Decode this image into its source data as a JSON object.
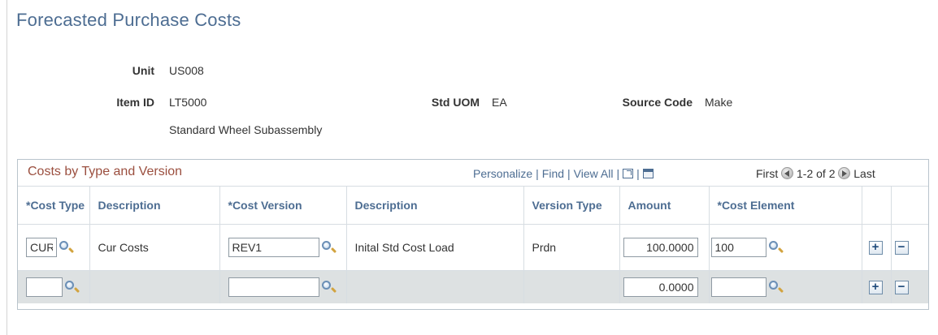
{
  "page": {
    "title": "Forecasted Purchase Costs"
  },
  "header": {
    "unit_label": "Unit",
    "unit_value": "US008",
    "item_label": "Item ID",
    "item_value": "LT5000",
    "item_description": "Standard Wheel Subassembly",
    "uom_label": "Std UOM",
    "uom_value": "EA",
    "source_label": "Source Code",
    "source_value": "Make"
  },
  "grid": {
    "title": "Costs by Type and Version",
    "nav": {
      "personalize": "Personalize",
      "find": "Find",
      "view_all": "View All"
    },
    "pager": {
      "first": "First",
      "range": "1-2 of 2",
      "last": "Last"
    },
    "columns": {
      "cost_type": "*Cost Type",
      "description": "Description",
      "cost_version": "*Cost Version",
      "version_description": "Description",
      "version_type": "Version Type",
      "amount": "Amount",
      "cost_element": "*Cost Element"
    },
    "rows": [
      {
        "cost_type": "CUR",
        "description": "Cur Costs",
        "cost_version": "REV1",
        "version_description": "Inital Std Cost Load",
        "version_type": "Prdn",
        "amount": "100.0000",
        "cost_element": "100"
      },
      {
        "cost_type": "",
        "description": "",
        "cost_version": "",
        "version_description": "",
        "version_type": "",
        "amount": "0.0000",
        "cost_element": ""
      }
    ],
    "icons": {
      "lookup": "magnifier-icon",
      "add": "plus-icon",
      "delete": "minus-icon",
      "zoom": "zoom-icon",
      "excel": "spreadsheet-icon"
    }
  }
}
